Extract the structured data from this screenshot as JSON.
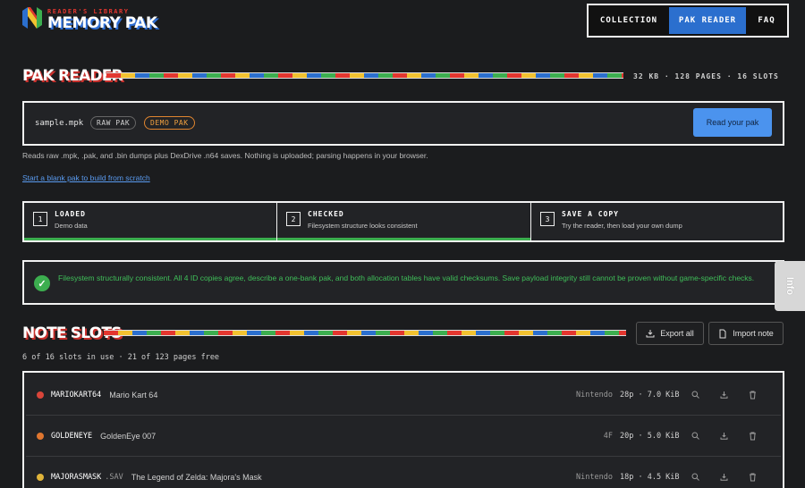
{
  "brand": {
    "subtitle": "READER'S LIBRARY",
    "title": "MEMORY PAK",
    "logo_icon": "n64-n-logo-icon"
  },
  "nav": [
    {
      "label": "COLLECTION",
      "active": false
    },
    {
      "label": "PAK READER",
      "active": true
    },
    {
      "label": "FAQ",
      "active": false
    }
  ],
  "reader": {
    "title": "PAK READER",
    "stats": "32 KB · 128 PAGES · 16 SLOTS",
    "file_name": "sample.mpk",
    "badge_raw": "RAW PAK",
    "badge_demo": "DEMO PAK",
    "read_button": "Read your pak",
    "helper": "Reads raw .mpk, .pak, and .bin dumps plus DexDrive .n64 saves. Nothing is uploaded; parsing happens in your browser.",
    "blank_link": "Start a blank pak to build from scratch"
  },
  "steps": [
    {
      "num": "1",
      "title": "LOADED",
      "desc": "Demo data",
      "complete": true
    },
    {
      "num": "2",
      "title": "CHECKED",
      "desc": "Filesystem structure looks consistent",
      "complete": true
    },
    {
      "num": "3",
      "title": "SAVE A COPY",
      "desc": "Try the reader, then load your own dump",
      "complete": false
    }
  ],
  "alert": {
    "text": "Filesystem structurally consistent. All 4 ID copies agree, describe a one-bank pak, and both allocation tables have valid checksums. Save payload integrity still cannot be proven without game-specific checks.",
    "color": "#3fbf59"
  },
  "side_tab": "Info",
  "slots": {
    "title": "NOTE SLOTS",
    "export_label": "Export all",
    "import_label": "Import note",
    "meta": "6 of 16 slots in use · 21 of 123 pages free",
    "rows": [
      {
        "color": "#d9453a",
        "code": "MARIOKART64",
        "ext": "",
        "name": "Mario Kart 64",
        "publisher": "Nintendo",
        "size": "28p · 7.0 KiB"
      },
      {
        "color": "#e0762f",
        "code": "GOLDENEYE",
        "ext": "",
        "name": "GoldenEye 007",
        "publisher": "4F",
        "size": "20p · 5.0 KiB"
      },
      {
        "color": "#e0b43a",
        "code": "MAJORASMASK",
        "ext": ".SAV",
        "name": "The Legend of Zelda: Majora's Mask",
        "publisher": "Nintendo",
        "size": "18p · 4.5 KiB"
      }
    ]
  }
}
